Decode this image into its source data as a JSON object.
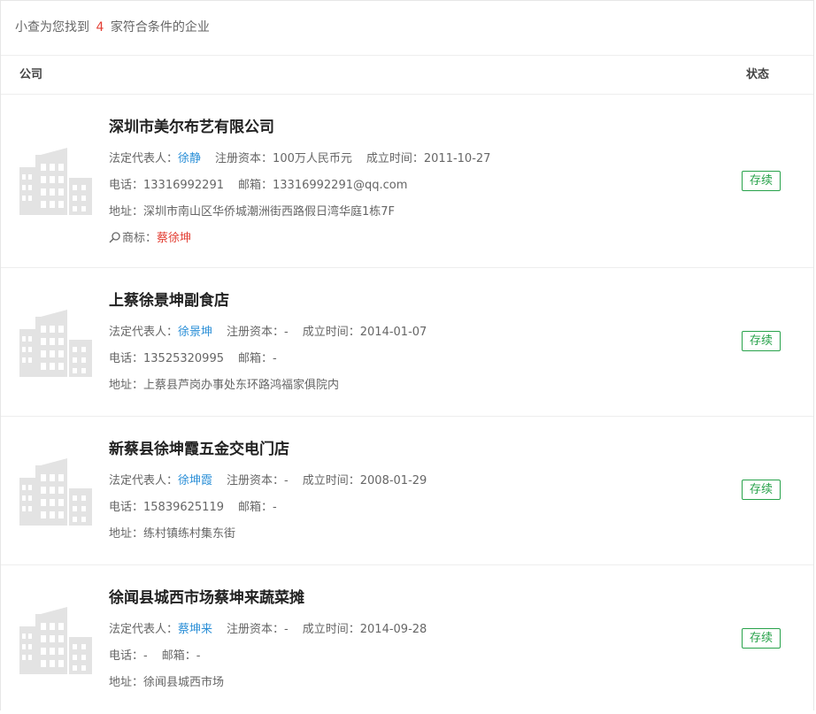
{
  "summary": {
    "prefix": "小查为您找到",
    "count": "4",
    "suffix": "家符合条件的企业"
  },
  "table": {
    "col_company": "公司",
    "col_status": "状态"
  },
  "labels": {
    "legal_rep": "法定代表人：",
    "capital": "注册资本：",
    "founded": "成立时间：",
    "phone": "电话：",
    "email": "邮箱：",
    "address": "地址：",
    "trademark": "商标："
  },
  "icons": {
    "logo": "building-icon",
    "trademark": "magnifier-icon"
  },
  "colors": {
    "link": "#2b8fd7",
    "highlight": "#e33e33",
    "status": "#27a24a"
  },
  "companies": [
    {
      "name": "深圳市美尔布艺有限公司",
      "legal_rep": "徐静",
      "capital": "100万人民币元",
      "founded": "2011-10-27",
      "phone": "13316992291",
      "email": "13316992291@qq.com",
      "address": "深圳市南山区华侨城潮洲街西路假日湾华庭1栋7F",
      "trademark": "蔡徐坤",
      "status": "存续"
    },
    {
      "name": "上蔡徐景坤副食店",
      "legal_rep": "徐景坤",
      "capital": "-",
      "founded": "2014-01-07",
      "phone": "13525320995",
      "email": "-",
      "address": "上蔡县芦岗办事处东环路鸿福家俱院内",
      "status": "存续"
    },
    {
      "name": "新蔡县徐坤霞五金交电门店",
      "legal_rep": "徐坤霞",
      "capital": "-",
      "founded": "2008-01-29",
      "phone": "15839625119",
      "email": "-",
      "address": "练村镇练村集东街",
      "status": "存续"
    },
    {
      "name": "徐闻县城西市场蔡坤来蔬菜摊",
      "legal_rep": "蔡坤来",
      "capital": "-",
      "founded": "2014-09-28",
      "phone": "-",
      "email": "-",
      "address": "徐闻县城西市场",
      "status": "存续"
    }
  ]
}
